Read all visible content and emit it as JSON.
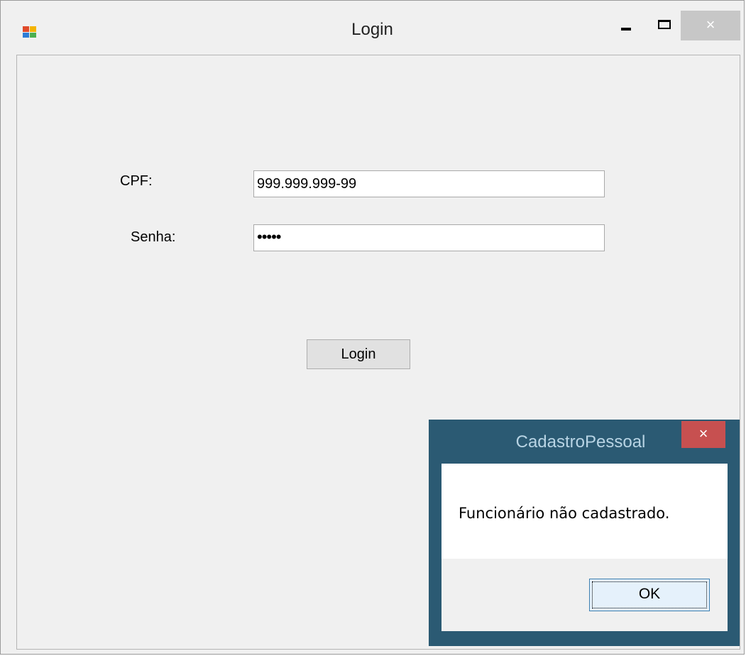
{
  "window": {
    "title": "Login",
    "controls": {
      "minimize_icon": "minimize-icon",
      "maximize_icon": "maximize-icon",
      "close_label": "×"
    }
  },
  "form": {
    "cpf_label": "CPF:",
    "cpf_value": "999.999.999-99",
    "senha_label": "Senha:",
    "senha_value": "•••••",
    "login_button": "Login"
  },
  "dialog": {
    "title": "CadastroPessoal",
    "close_label": "×",
    "message": "Funcionário não cadastrado.",
    "ok_button": "OK"
  },
  "colors": {
    "dialog_frame": "#2b5a73",
    "dialog_close": "#c75050",
    "window_bg": "#f0f0f0"
  }
}
